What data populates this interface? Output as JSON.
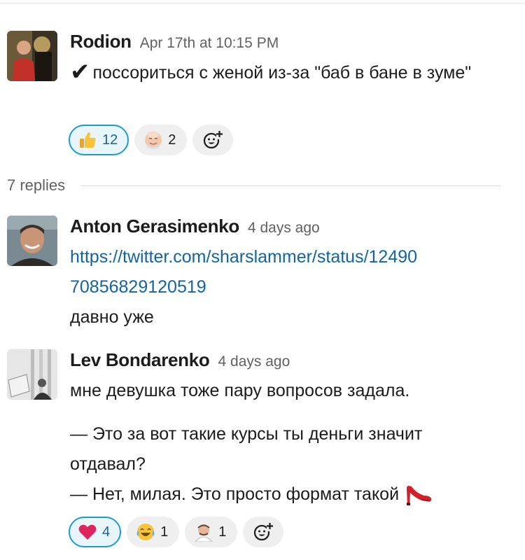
{
  "messages": [
    {
      "name": "Rodion",
      "time": "Apr 17th at 10:15 PM",
      "check": "✔",
      "text": "поссориться с женой из-за \"баб в бане в зуме\"",
      "reactions": [
        {
          "emoji": "thumbs-up",
          "count": "12",
          "active": true
        },
        {
          "emoji": "bald-face",
          "count": "2",
          "active": false
        }
      ]
    },
    {
      "name": "Anton Gerasimenko",
      "time": "4 days ago",
      "link_line1": "https://twitter.com/sharslammer/status/12490",
      "link_line2": "70856829120519",
      "text": "давно уже"
    },
    {
      "name": "Lev Bondarenko",
      "time": "4 days ago",
      "line1": "мне девушка тоже пару вопросов задала.",
      "line2": "— Это за вот такие курсы ты деньги значит",
      "line3": "отдавал?",
      "line4": "— Нет, милая. Это просто формат такой",
      "reactions": [
        {
          "emoji": "heart",
          "count": "4",
          "active": true
        },
        {
          "emoji": "joy",
          "count": "1",
          "active": false
        },
        {
          "emoji": "chef-face",
          "count": "1",
          "active": false
        }
      ]
    }
  ],
  "thread": {
    "replies_label": "7 replies"
  },
  "colors": {
    "link": "#1264a3",
    "active_border": "#1d9bd1",
    "active_bg": "#e8f5fa",
    "muted": "#616061"
  },
  "icons": [
    "add-reaction-icon",
    "high-heel-icon",
    "checkmark-icon"
  ]
}
